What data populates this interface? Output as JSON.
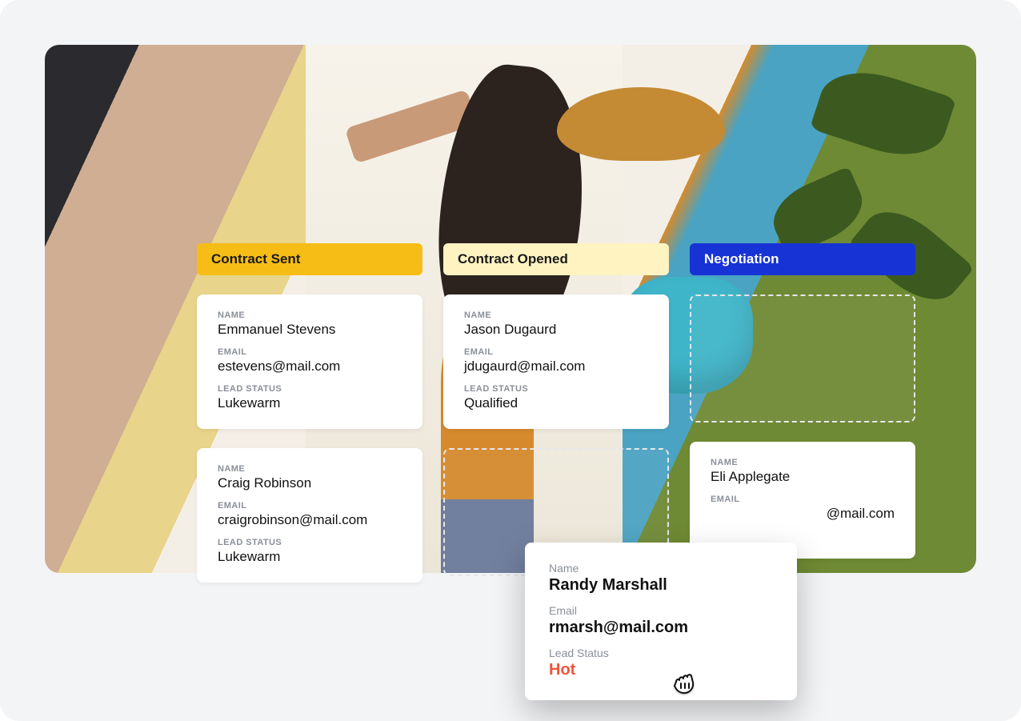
{
  "columns": [
    {
      "title": "Contract Sent"
    },
    {
      "title": "Contract Opened"
    },
    {
      "title": "Negotiation"
    }
  ],
  "labels": {
    "name": "NAME",
    "email": "EMAIL",
    "status": "LEAD STATUS",
    "name_tc": "Name",
    "email_tc": "Email",
    "status_tc": "Lead Status"
  },
  "cards": {
    "c1": {
      "name": "Emmanuel Stevens",
      "email": "estevens@mail.com",
      "status": "Lukewarm"
    },
    "c2": {
      "name": "Craig Robinson",
      "email": "craigrobinson@mail.com",
      "status": "Lukewarm"
    },
    "c3": {
      "name": "Jason Dugaurd",
      "email": "jdugaurd@mail.com",
      "status": "Qualified"
    },
    "c4": {
      "name": "Eli Applegate",
      "email_suffix": "@mail.com",
      "status": ""
    }
  },
  "dragging": {
    "name": "Randy Marshall",
    "email": "rmarsh@mail.com",
    "status": "Hot"
  }
}
